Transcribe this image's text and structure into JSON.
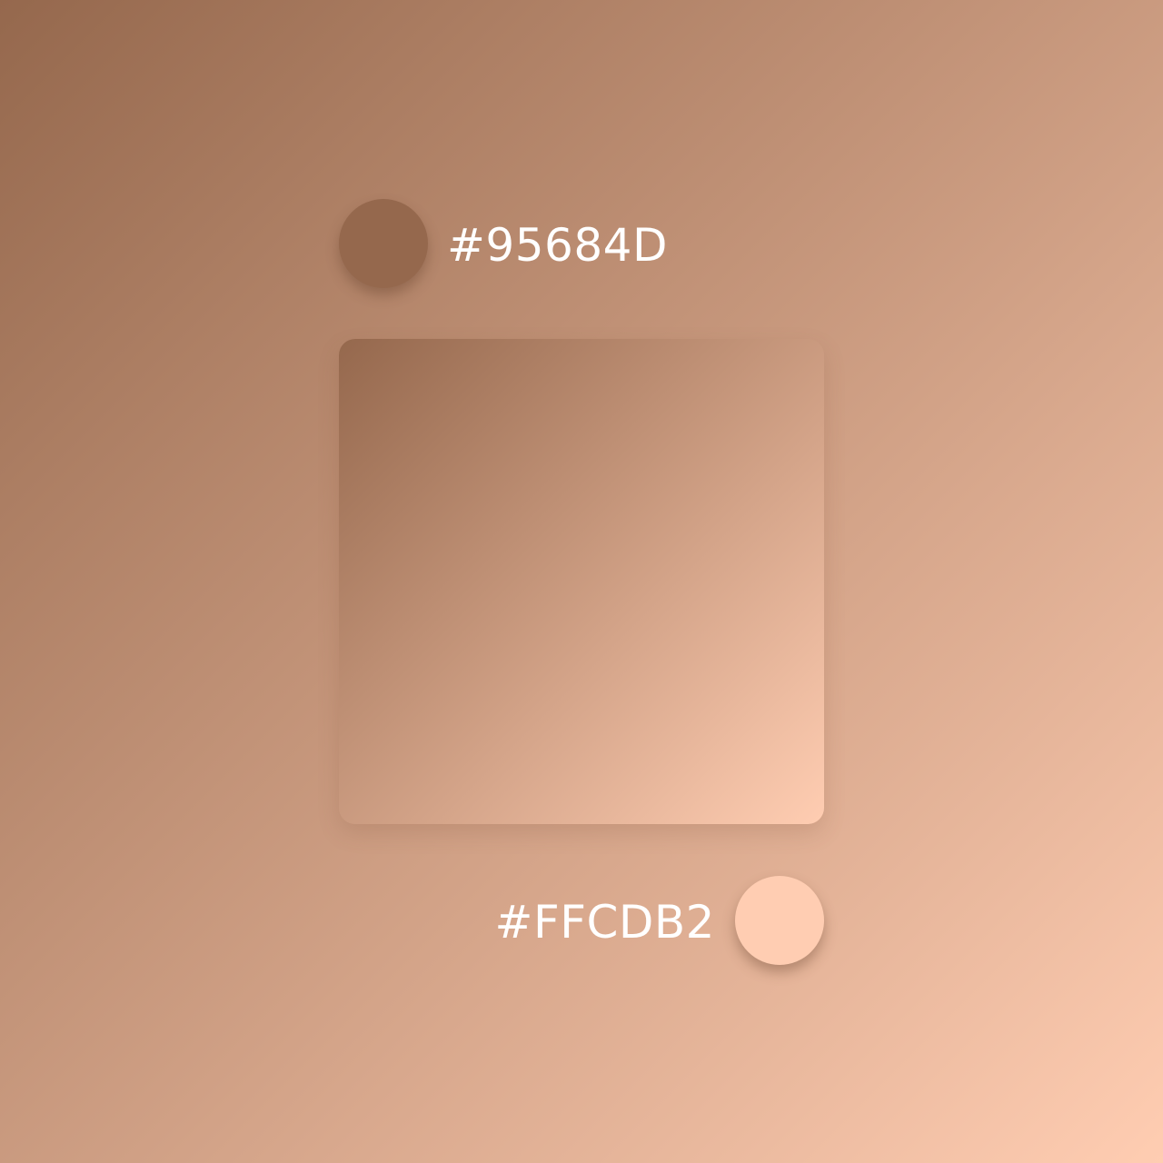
{
  "gradient": {
    "start_color": "#95684D",
    "end_color": "#FFCDB2"
  },
  "labels": {
    "start_hex": "#95684D",
    "end_hex": "#FFCDB2"
  }
}
